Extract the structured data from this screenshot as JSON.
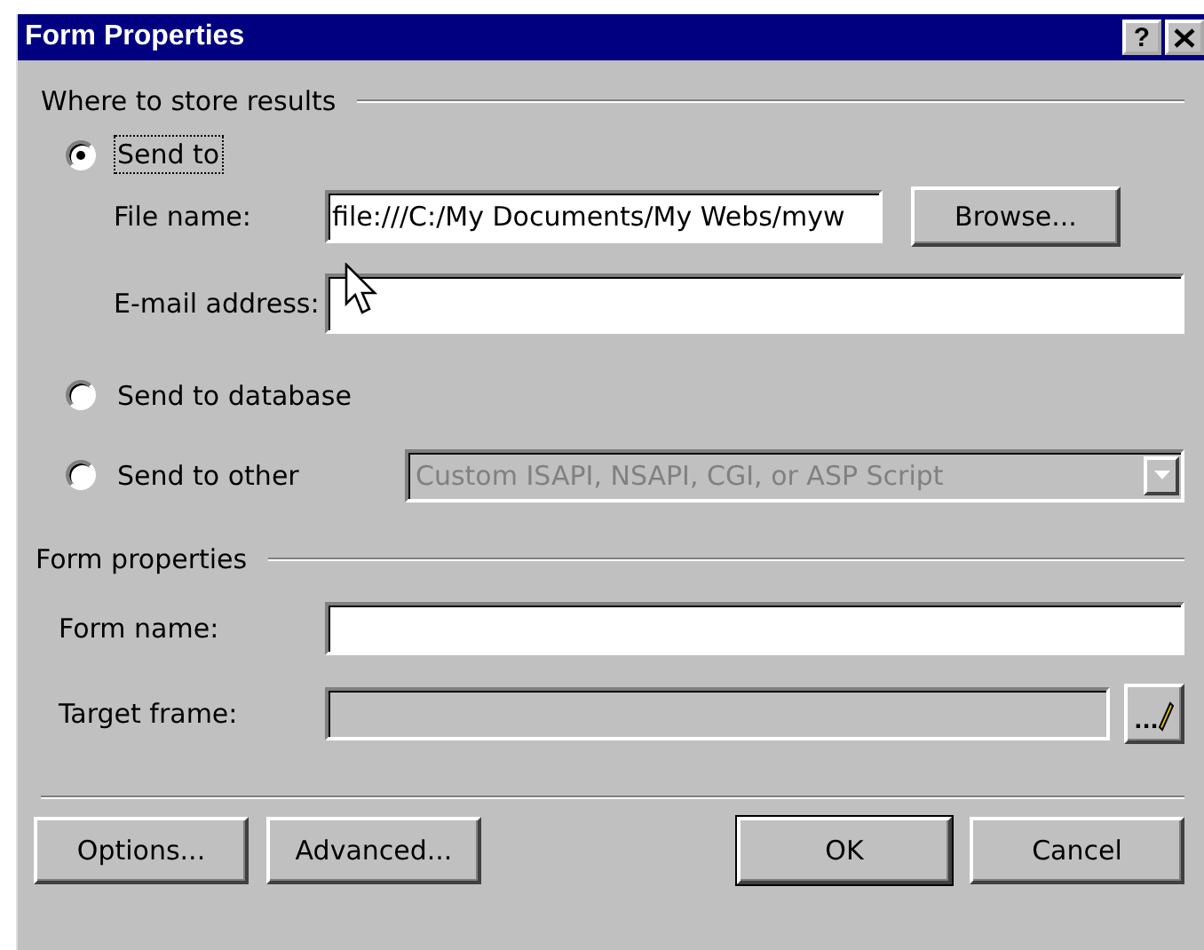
{
  "window": {
    "title": "Form Properties",
    "help_button": "?"
  },
  "store_results": {
    "heading": "Where to store results",
    "options": [
      {
        "label": "Send to",
        "selected": true,
        "focused": true
      },
      {
        "label": "Send to database",
        "selected": false,
        "focused": false
      },
      {
        "label": "Send to other",
        "selected": false,
        "focused": false
      }
    ],
    "file_name": {
      "label": "File name:",
      "value": "file:///C:/My Documents/My Webs/myw"
    },
    "browse_button": "Browse...",
    "email": {
      "label": "E-mail address:"
    },
    "other_select": {
      "value": "Custom ISAPI, NSAPI, CGI, or ASP Script",
      "disabled": true
    }
  },
  "form_properties": {
    "heading": "Form properties",
    "form_name": {
      "label": "Form name:",
      "disabled": false
    },
    "target_frame": {
      "label": "Target frame:",
      "disabled": true
    },
    "target_button": "..."
  },
  "buttons": [
    {
      "label": "Options...",
      "default": false
    },
    {
      "label": "Advanced...",
      "default": false
    },
    {
      "label": "OK",
      "default": true
    },
    {
      "label": "Cancel",
      "default": false
    }
  ]
}
